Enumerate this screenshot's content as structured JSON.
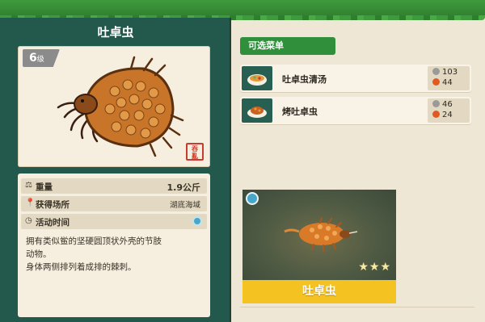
{
  "creature": {
    "name": "吐卓虫",
    "level": "6",
    "level_unit": "级",
    "seal_text": "吞亂"
  },
  "info": {
    "weight_label": "重量",
    "weight_value": "1.9公斤",
    "location_label": "获得场所",
    "location_value": "湖底海域",
    "time_label": "活动时间",
    "description_line1": "拥有类似鲎的坚硬圆顶状外壳的节肢",
    "description_line2": "动物。",
    "description_line3": "身体两侧排列着成排的棘刺。"
  },
  "menu": {
    "header": "可选菜单",
    "items": [
      {
        "name": "吐卓虫清汤",
        "price": "103",
        "heat": "44"
      },
      {
        "name": "烤吐卓虫",
        "price": "46",
        "heat": "24"
      }
    ]
  },
  "catch_card": {
    "name": "吐卓虫",
    "stars": 3,
    "star_glyphs": "★★★"
  },
  "colors": {
    "panel_green": "#23584d",
    "accent_green": "#2f8f3b",
    "banner_yellow": "#f4c322",
    "background": "#efe7d6"
  }
}
